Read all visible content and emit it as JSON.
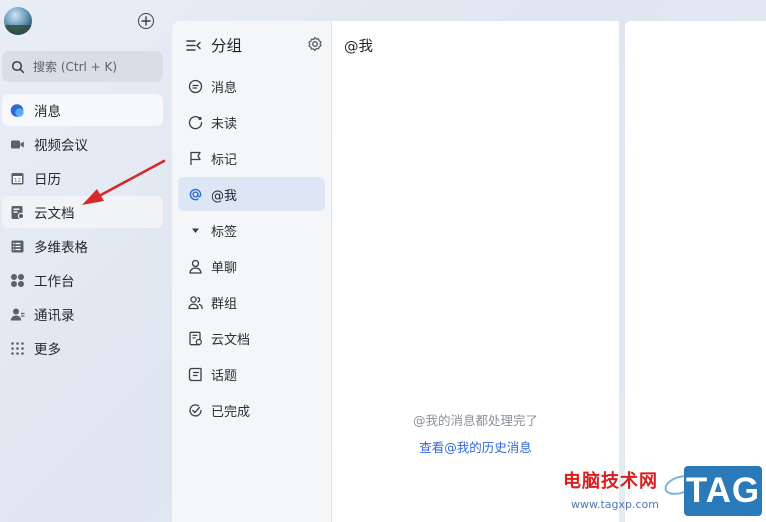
{
  "sidebar": {
    "search_placeholder": "搜索 (Ctrl + K)",
    "items": [
      {
        "label": "消息",
        "icon": "message-bubble-icon"
      },
      {
        "label": "视频会议",
        "icon": "video-camera-icon"
      },
      {
        "label": "日历",
        "icon": "calendar-icon"
      },
      {
        "label": "云文档",
        "icon": "cloud-doc-icon"
      },
      {
        "label": "多维表格",
        "icon": "table-icon"
      },
      {
        "label": "工作台",
        "icon": "workspace-grid-icon"
      },
      {
        "label": "通讯录",
        "icon": "contacts-icon"
      },
      {
        "label": "更多",
        "icon": "more-dots-icon"
      }
    ],
    "calendar_day": "12"
  },
  "groups": {
    "title": "分组",
    "items": [
      {
        "label": "消息",
        "icon": "chat-icon"
      },
      {
        "label": "未读",
        "icon": "unread-icon"
      },
      {
        "label": "标记",
        "icon": "flag-icon"
      },
      {
        "label": "@我",
        "icon": "at-icon"
      },
      {
        "label": "标签",
        "icon": "tag-triangle-icon"
      },
      {
        "label": "单聊",
        "icon": "person-icon"
      },
      {
        "label": "群组",
        "icon": "group-icon"
      },
      {
        "label": "云文档",
        "icon": "doc-icon"
      },
      {
        "label": "话题",
        "icon": "topic-icon"
      },
      {
        "label": "已完成",
        "icon": "check-circle-icon"
      }
    ]
  },
  "main": {
    "title": "@我",
    "empty_message": "@我的消息都处理完了",
    "history_link": "查看@我的历史消息"
  },
  "watermark": {
    "site_name": "电脑技术网",
    "url": "www.tagxp.com",
    "tag": "TAG"
  },
  "colors": {
    "accent_blue": "#2f6ad4",
    "active_group_bg": "#dde6f4",
    "annotation_arrow": "#d42a2a",
    "watermark_red": "#d81e1e",
    "watermark_tag_bg": "#2a79b8"
  }
}
